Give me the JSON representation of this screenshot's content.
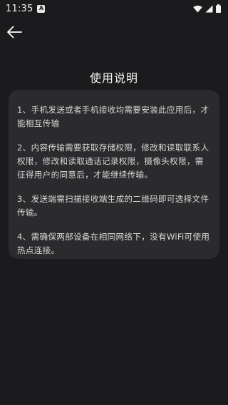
{
  "status_bar": {
    "time": "11:35",
    "left_icon": "A",
    "icons": [
      "wifi-icon",
      "signal-icon",
      "battery-icon"
    ]
  },
  "header": {
    "back_icon": "arrow-left-icon"
  },
  "page": {
    "title": "使用说明"
  },
  "instructions": [
    {
      "text": "1、手机发送或者手机接收均需要安装此应用后，才能相互传输"
    },
    {
      "text": "2、内容传输需要获取存储权限，修改和读取联系人权限，修改和读取通话记录权限，摄像头权限，需征得用户的同意后，才能继续传输。"
    },
    {
      "text": "3、发送端需扫描接收端生成的二维码即可选择文件传输。"
    },
    {
      "text": "4、需确保两部设备在相同网络下，没有WiFi可使用热点连接。"
    }
  ],
  "colors": {
    "background": "#1b1b1d",
    "card": "#2b2b2e",
    "text": "#d6d6d6"
  }
}
